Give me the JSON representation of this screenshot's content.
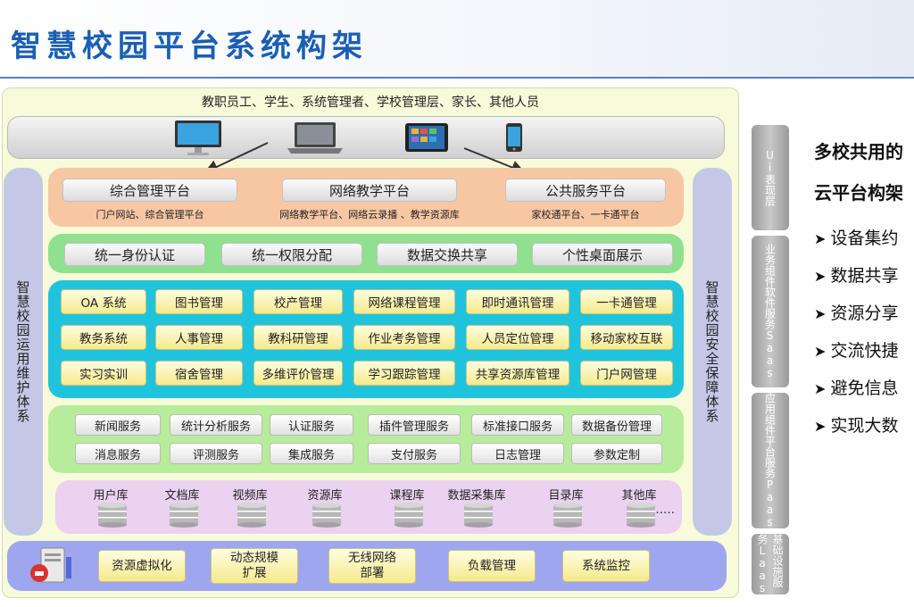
{
  "title": "智慧校园平台系统构架",
  "users": "教职员工、学生、系统管理者、学校管理层、家长、其他人员",
  "devices": [
    {
      "icon": "desktop-icon"
    },
    {
      "icon": "laptop-icon"
    },
    {
      "icon": "tablet-icon"
    },
    {
      "icon": "phone-icon"
    }
  ],
  "left_side": "智慧校园运用维护体系",
  "right_side": "智慧校园安全保障体系",
  "platforms": [
    {
      "name": "综合管理平台",
      "sub": "门户网站、综合管理平台"
    },
    {
      "name": "网络教学平台",
      "sub": "网络教学平台、网络云录播 、教学资源库"
    },
    {
      "name": "公共服务平台",
      "sub": "家校通平台、一卡通平台"
    }
  ],
  "unified": [
    "统一身份认证",
    "统一权限分配",
    "数据交换共享",
    "个性桌面展示"
  ],
  "apps": [
    [
      "OA 系统",
      "图书管理",
      "校产管理",
      "网络课程管理",
      "即时通讯管理",
      "一卡通管理"
    ],
    [
      "教务系统",
      "人事管理",
      "教科研管理",
      "作业考务管理",
      "人员定位管理",
      "移动家校互联"
    ],
    [
      "实习实训",
      "宿舍管理",
      "多维评价管理",
      "学习跟踪管理",
      "共享资源库管理",
      "门户网管理"
    ]
  ],
  "services": [
    [
      "新闻服务",
      "统计分析服务",
      "认证服务",
      "插件管理服务",
      "标准接口服务",
      "数据备份管理"
    ],
    [
      "消息服务",
      "评测服务",
      "集成服务",
      "支付服务",
      "日志管理",
      "参数定制"
    ]
  ],
  "databases": [
    "用户库",
    "文档库",
    "视频库",
    "资源库",
    "课程库",
    "数据采集库",
    "目录库",
    "其他库"
  ],
  "db_more": "……",
  "infra": [
    "资源虚拟化",
    "动态规模\n扩展",
    "无线网络\n部署",
    "负载管理",
    "系统监控"
  ],
  "layers": [
    "Ui表现层",
    "业务组件软件服务Saas",
    "应用组件平台服务Paas",
    "基础设施服务Laas"
  ],
  "right_panel": {
    "heading1": "多校共用的",
    "heading2": "云平台构架",
    "bullets": [
      "设备集约",
      "数据共享",
      "资源分享",
      "交流快捷",
      "避免信息",
      "实现大数"
    ]
  },
  "colors": {
    "title": "#1a5fb4",
    "platform_band": "#f7c7a4",
    "unified_band": "#8fe08f",
    "apps_band": "#1fc4dc",
    "services_band": "#b6ec9a",
    "db_band": "#ead2f0",
    "infra_band": "#9ea6f0",
    "side_pill": "#c4c8e6"
  }
}
